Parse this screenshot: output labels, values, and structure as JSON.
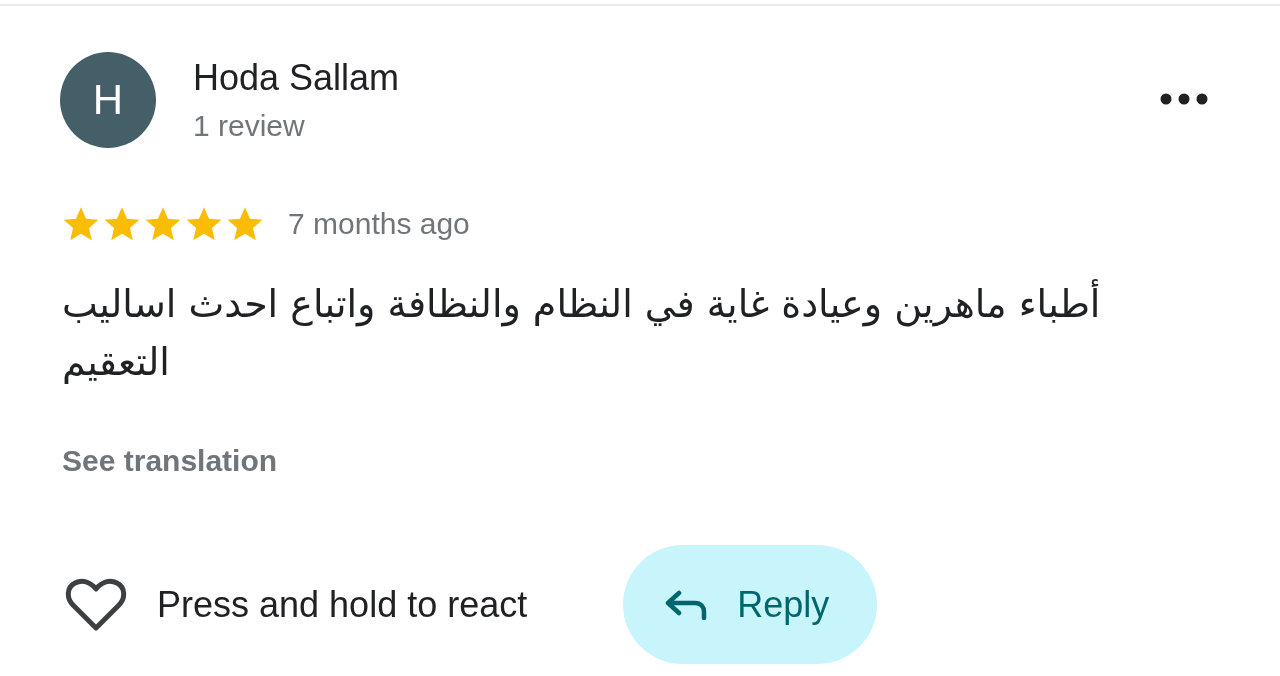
{
  "reviewer": {
    "initial": "H",
    "name": "Hoda Sallam",
    "review_count": "1 review"
  },
  "rating": {
    "stars": 5,
    "time": "7 months ago"
  },
  "review_text": "أطباء ماهرين وعيادة غاية في النظام والنظافة واتباع احدث اساليب التعقيم",
  "translate_link": "See translation",
  "actions": {
    "react_label": "Press and hold to react",
    "reply_label": "Reply"
  }
}
